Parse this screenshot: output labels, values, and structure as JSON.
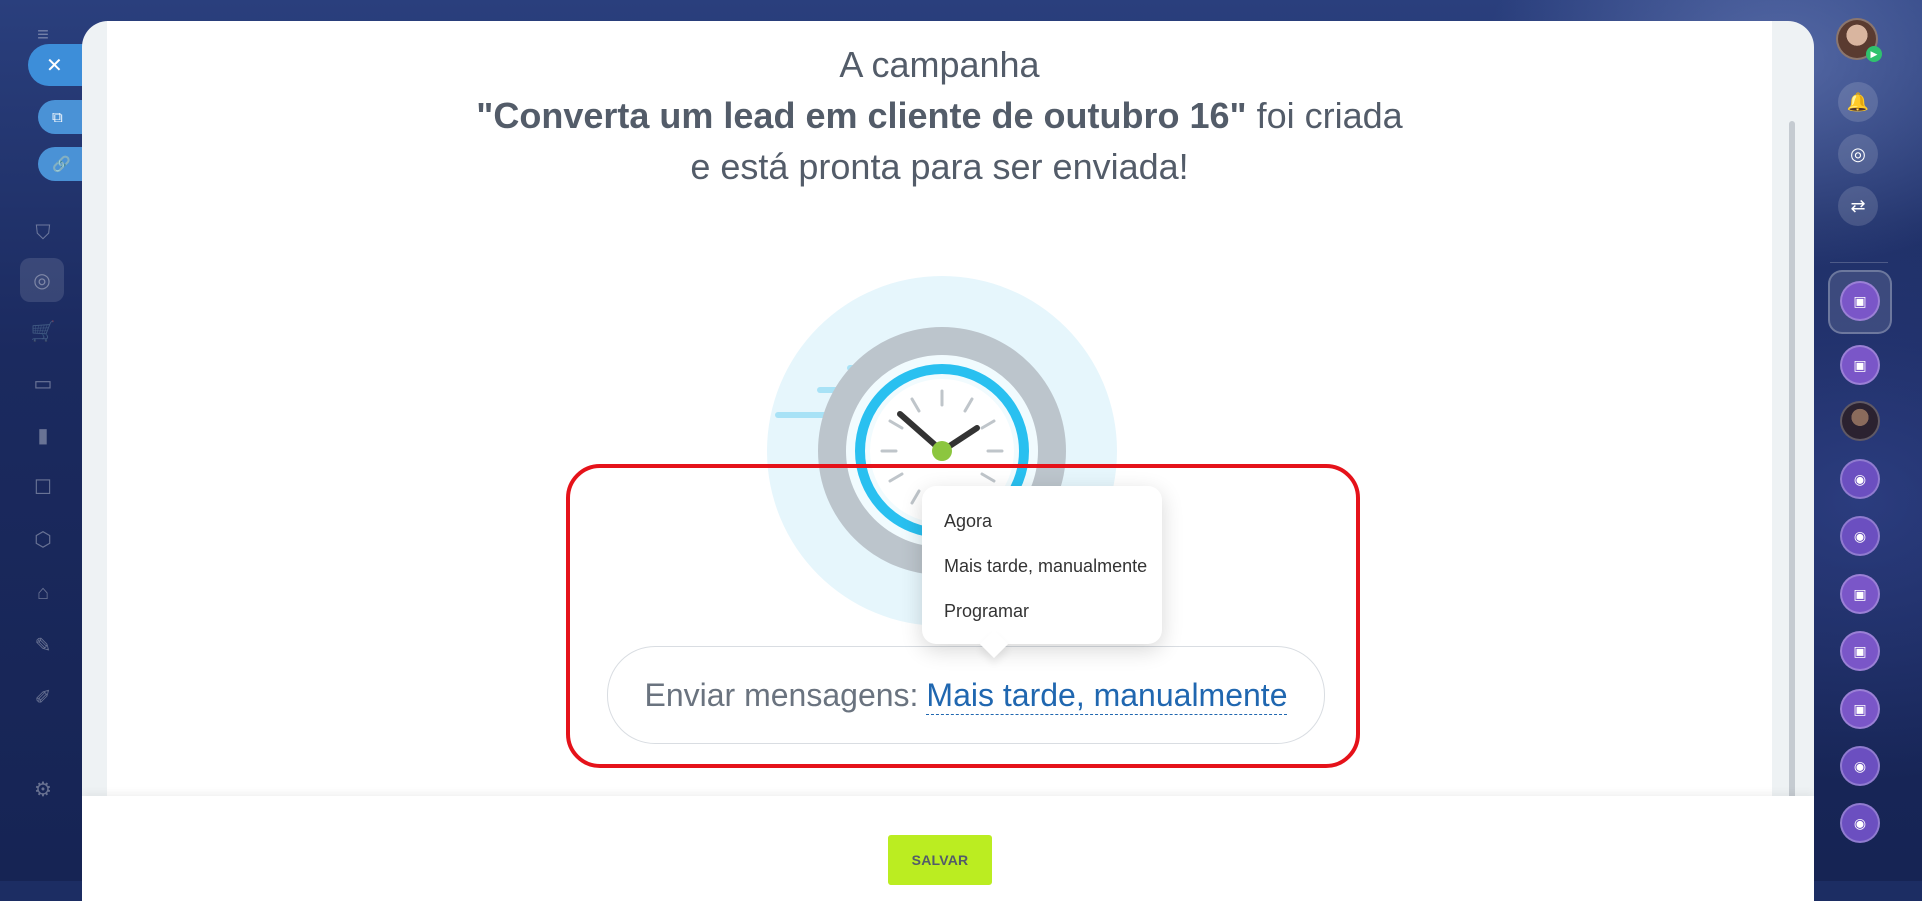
{
  "left_sidebar": {
    "close_icon": "close-icon",
    "external_link_icon": "external-link-icon",
    "link_icon": "link-icon",
    "items": [
      "menu-icon",
      "car-icon",
      "mail-icon",
      "funnel-icon",
      "target-icon",
      "cart-icon",
      "id-card-icon",
      "chart-icon",
      "robot-icon",
      "box-icon",
      "warehouse-icon",
      "pen-icon",
      "doc-edit-icon",
      "settings-icon"
    ]
  },
  "heading": {
    "line1": "A campanha",
    "campaign_name": "\"Converta um lead em cliente de outubro 16\"",
    "line2_suffix": " foi criada",
    "line3": "e está pronta para ser enviada!"
  },
  "send": {
    "label": "Enviar mensagens:",
    "value": "Mais tarde, manualmente"
  },
  "menu": {
    "items": [
      "Agora",
      "Mais tarde, manualmente",
      "Programar"
    ]
  },
  "footer": {
    "save_label": "SALVAR"
  },
  "colors": {
    "accent_link": "#2067b0",
    "save_button": "#bbed21",
    "highlight": "#e5121a",
    "clock_ring": "#29c0f0",
    "clock_center": "#8cc63f"
  }
}
